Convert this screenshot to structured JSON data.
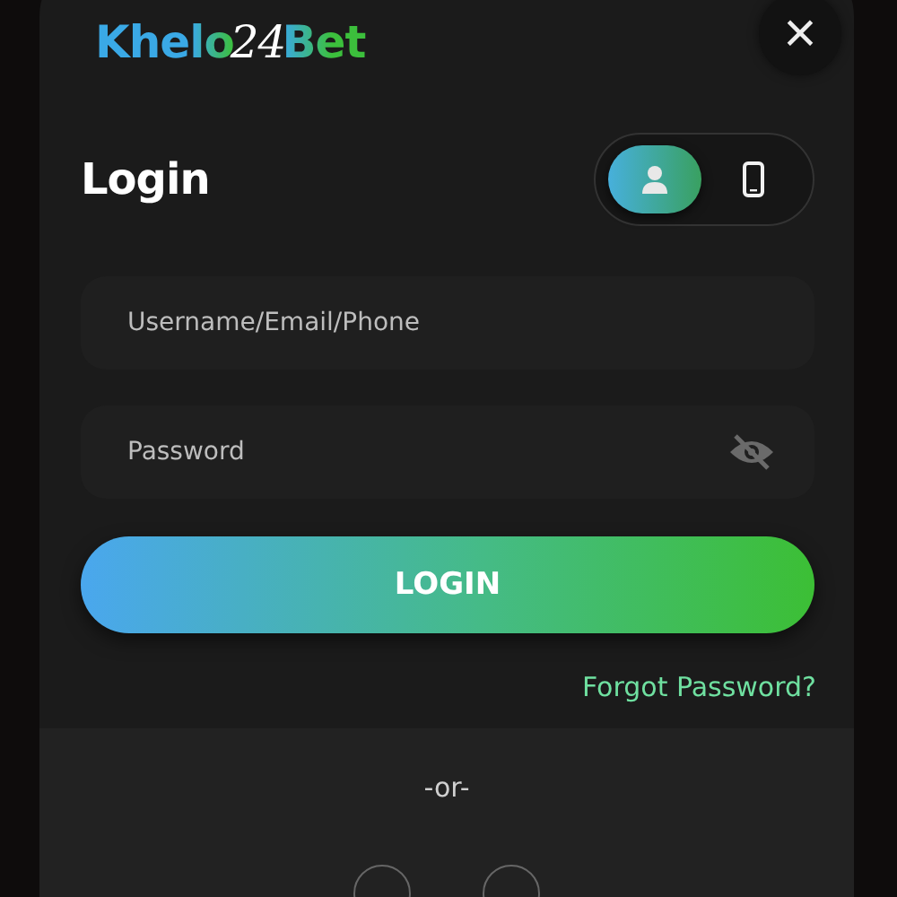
{
  "logo": {
    "parts": [
      "Khelo",
      "24",
      "Bet"
    ]
  },
  "close_button": {
    "label": "×"
  },
  "title": "Login",
  "login_modes": [
    {
      "kind": "user",
      "selected": true
    },
    {
      "kind": "phone",
      "selected": false
    }
  ],
  "fields": [
    {
      "kind": "text",
      "placeholder": "Username/Email/Phone"
    },
    {
      "kind": "password",
      "placeholder": "Password"
    }
  ],
  "login_button": "LOGIN",
  "forgot_link": "Forgot Password?",
  "divider": "-or-",
  "social_buttons": [
    {
      "kind": "round"
    },
    {
      "kind": "round"
    }
  ]
}
